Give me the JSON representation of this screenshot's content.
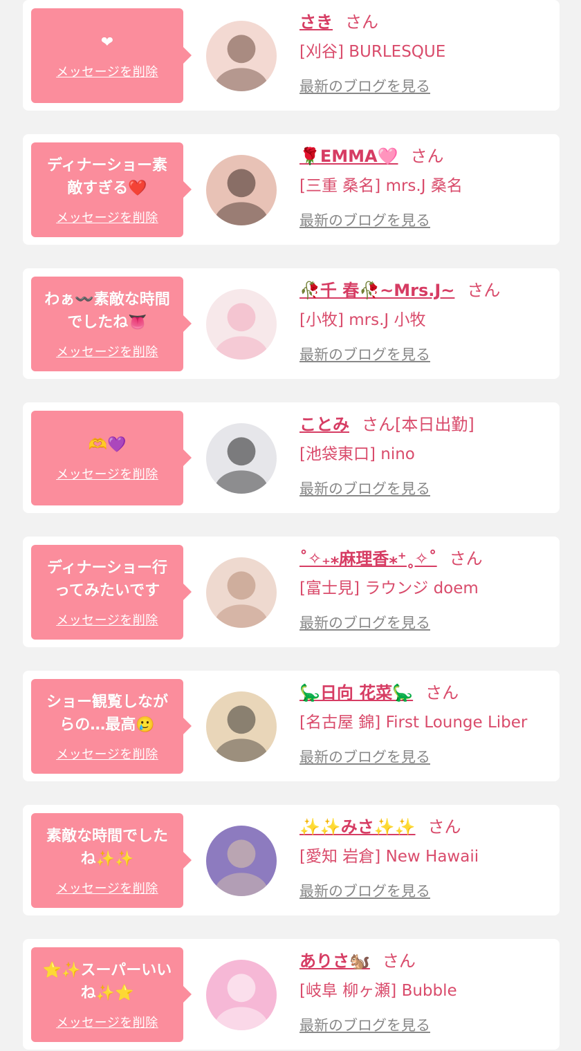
{
  "delete_label": "メッセージを削除",
  "blog_label": "最新のブログを見る",
  "colors": {
    "bubble": "#fb8d9c",
    "name": "#d63c63",
    "text": "#d94b6b",
    "link": "#888888"
  },
  "cards": [
    {
      "message": "❤",
      "name": "さき",
      "suffix": "さん",
      "shop": "[刈谷] BURLESQUE",
      "avatar": [
        "#f3d9d2",
        "#6b4a3e"
      ]
    },
    {
      "message": "ディナーショー素\n敵すぎる❤️",
      "name": "🌹EMMA🩷",
      "suffix": "さん",
      "shop": "[三重 桑名] mrs.J 桑名",
      "avatar": [
        "#e8c2b6",
        "#3b2a24"
      ]
    },
    {
      "message": "わぁ〰️素敵な時間\nでしたね👅",
      "name": "🥀千 春🥀~Mrs.J~",
      "suffix": "さん",
      "shop": "[小牧] mrs.J 小牧",
      "avatar": [
        "#f7e8ea",
        "#f2a7bc"
      ]
    },
    {
      "message": "🫶💜",
      "name": "ことみ",
      "suffix": "さん[本日出勤]",
      "shop": "[池袋東口] nino",
      "avatar": [
        "#e6e6ea",
        "#222222"
      ]
    },
    {
      "message": "ディナーショー行\nってみたいです",
      "name": "˚✧₊⁎麻理香⁎⁺˳✧˚",
      "suffix": "さん",
      "shop": "[富士見] ラウンジ doem",
      "avatar": [
        "#eed9cf",
        "#b78a74"
      ]
    },
    {
      "message": "ショー観覧しなが\nらの…最高🥲",
      "name": "🦕日向 花菜🦕",
      "suffix": "さん",
      "shop": "[名古屋 錦] First Lounge Liber",
      "avatar": [
        "#e9d6b9",
        "#3d3a35"
      ]
    },
    {
      "message": "素敵な時間でした\nね✨✨",
      "name": "✨✨みさ✨✨",
      "suffix": "さん",
      "shop": "[愛知 岩倉] New Hawaii",
      "avatar": [
        "#8d7bbf",
        "#e0c9a8"
      ]
    },
    {
      "message": "⭐✨スーパーいい\nね✨⭐",
      "name": "ありさ🐿️",
      "suffix": "さん",
      "shop": "[岐阜 柳ヶ瀬] Bubble",
      "avatar": [
        "#f6b8d6",
        "#ffffff"
      ]
    }
  ]
}
